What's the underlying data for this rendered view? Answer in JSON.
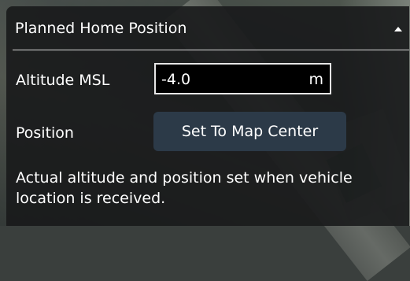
{
  "panel": {
    "title": "Planned Home Position",
    "collapse_icon": "chevron-up-icon"
  },
  "altitude": {
    "label": "Altitude MSL",
    "value": "-4.0",
    "unit": "m"
  },
  "position": {
    "label": "Position",
    "button_label": "Set To Map Center"
  },
  "info_text": "Actual altitude and position set when vehicle location is received.",
  "colors": {
    "panel_background": "#181a1b",
    "button_background": "#2c3a48",
    "field_background": "#000000",
    "field_border": "#e6e6e6",
    "text": "#ffffff"
  }
}
